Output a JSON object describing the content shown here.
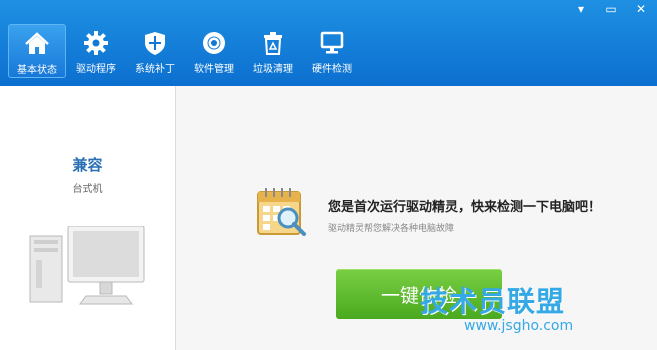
{
  "window": {
    "controls": [
      "▾",
      "▭",
      "✕"
    ]
  },
  "nav": [
    {
      "label": "基本状态",
      "icon": "home-icon",
      "active": true
    },
    {
      "label": "驱动程序",
      "icon": "gear-icon",
      "active": false
    },
    {
      "label": "系统补丁",
      "icon": "shield-icon",
      "active": false
    },
    {
      "label": "软件管理",
      "icon": "disc-icon",
      "active": false
    },
    {
      "label": "垃圾清理",
      "icon": "trash-icon",
      "active": false
    },
    {
      "label": "硬件检测",
      "icon": "monitor-icon",
      "active": false
    }
  ],
  "device": {
    "name": "兼容",
    "type": "台式机"
  },
  "main": {
    "headline": "您是首次运行驱动精灵，快来检测一下电脑吧！",
    "subline": "驱动精灵帮您解决各种电脑故障",
    "check_button": "一键体检"
  },
  "watermark": {
    "text": "技术员联盟",
    "url": "www.jsgho.com"
  },
  "colors": {
    "header": "#1583dc",
    "button": "#5bb82f",
    "accent": "#2a6fb6"
  }
}
